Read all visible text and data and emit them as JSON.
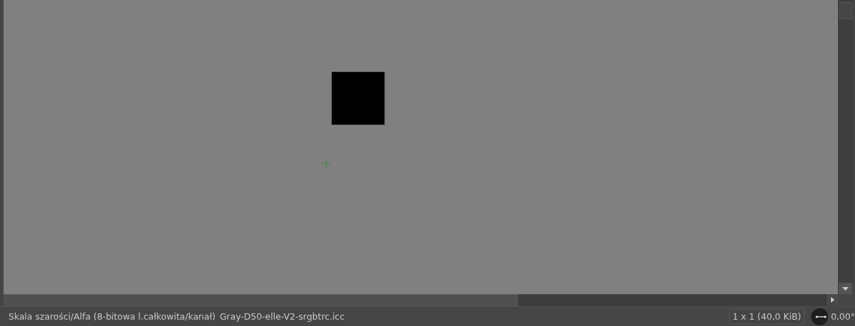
{
  "status_bar": {
    "image_mode": "Skala szarości/Alfa (8-bitowa l.całkowita/kanał)",
    "color_profile": "Gray-D50-elle-V2-srgbtrc.icc",
    "image_size": "1 x 1 (40,0 KiB)",
    "rotation": "0,00°"
  }
}
